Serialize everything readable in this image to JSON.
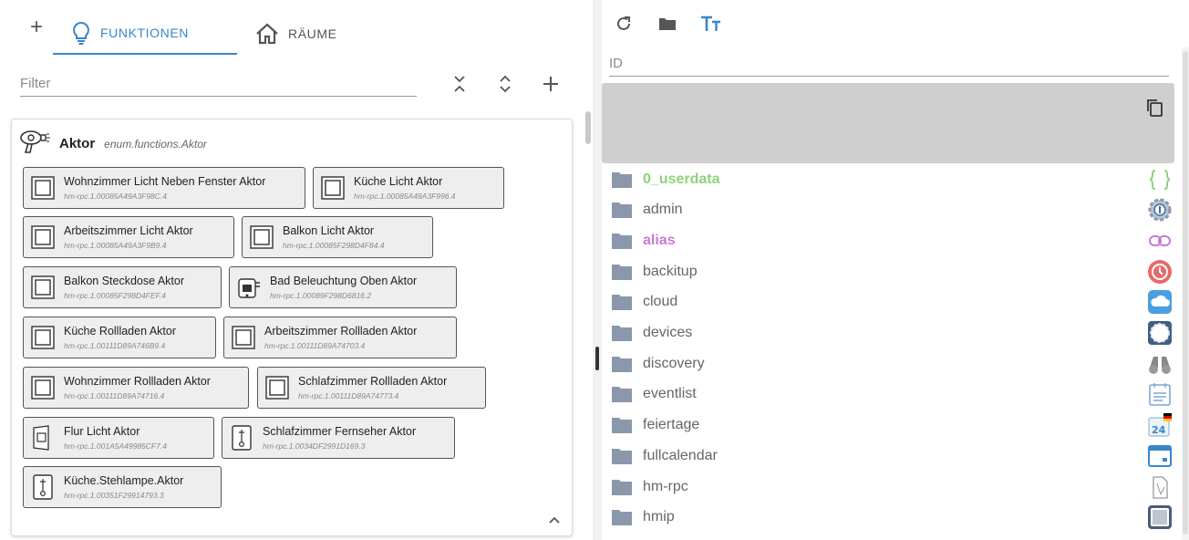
{
  "tabs": {
    "functions_label": "FUNKTIONEN",
    "rooms_label": "RÄUME"
  },
  "filter": {
    "placeholder": "Filter"
  },
  "enum": {
    "title": "Aktor",
    "id": "enum.functions.Aktor",
    "icon": "hair-dryer-icon",
    "members": [
      {
        "name": "Wohnzimmer Licht Neben Fenster Aktor",
        "id": "hm-rpc.1.00085A49A3F98C.4",
        "icon": "switch-icon"
      },
      {
        "name": "Küche Licht Aktor",
        "id": "hm-rpc.1.00085A49A3F996.4",
        "icon": "switch-icon"
      },
      {
        "name": "Arbeitszimmer Licht Aktor",
        "id": "hm-rpc.1.00085A49A3F9B9.4",
        "icon": "switch-icon"
      },
      {
        "name": "Balkon Licht Aktor",
        "id": "hm-rpc.1.00085F298D4F84.4",
        "icon": "switch-icon"
      },
      {
        "name": "Balkon Steckdose Aktor",
        "id": "hm-rpc.1.00085F298D4FEF.4",
        "icon": "switch-icon"
      },
      {
        "name": "Bad Beleuchtung Oben Aktor",
        "id": "hm-rpc.1.00089F298D6816.2",
        "icon": "flush-actuator-icon"
      },
      {
        "name": "Küche Rollladen Aktor",
        "id": "hm-rpc.1.00111D89A746B9.4",
        "icon": "switch-icon"
      },
      {
        "name": "Arbeitszimmer Rollladen Aktor",
        "id": "hm-rpc.1.00111D89A74703.4",
        "icon": "switch-icon"
      },
      {
        "name": "Wohnzimmer Rollladen Aktor",
        "id": "hm-rpc.1.00111D89A74716.4",
        "icon": "switch-icon"
      },
      {
        "name": "Schlafzimmer Rollladen Aktor",
        "id": "hm-rpc.1.00111D89A74773.4",
        "icon": "switch-icon"
      },
      {
        "name": "Flur Licht Aktor",
        "id": "hm-rpc.1.001A5A49985CF7.4",
        "icon": "door-switch-icon"
      },
      {
        "name": "Schlafzimmer Fernseher Aktor",
        "id": "hm-rpc.1.0034DF2991D169.3",
        "icon": "plug-switch-icon"
      },
      {
        "name": "Küche.Stehlampe.Aktor",
        "id": "hm-rpc.1.00351F29914793.3",
        "icon": "plug-switch-icon"
      }
    ]
  },
  "object_browser": {
    "id_placeholder": "ID",
    "items": [
      {
        "label": "0_userdata",
        "color": "#8fd27e",
        "bold": true,
        "icon": "braces-icon"
      },
      {
        "label": "admin",
        "color": "#666666",
        "bold": false,
        "icon": "admin-gear-icon"
      },
      {
        "label": "alias",
        "color": "#c77ad6",
        "bold": true,
        "icon": "link-icon"
      },
      {
        "label": "backitup",
        "color": "#666666",
        "bold": false,
        "icon": "backup-clock-icon"
      },
      {
        "label": "cloud",
        "color": "#666666",
        "bold": false,
        "icon": "cloud-icon"
      },
      {
        "label": "devices",
        "color": "#666666",
        "bold": false,
        "icon": "devices-icon"
      },
      {
        "label": "discovery",
        "color": "#666666",
        "bold": false,
        "icon": "binoculars-icon"
      },
      {
        "label": "eventlist",
        "color": "#666666",
        "bold": false,
        "icon": "eventlist-icon"
      },
      {
        "label": "feiertage",
        "color": "#666666",
        "bold": false,
        "icon": "calendar-24-icon"
      },
      {
        "label": "fullcalendar",
        "color": "#666666",
        "bold": false,
        "icon": "fullcalendar-icon"
      },
      {
        "label": "hm-rpc",
        "color": "#666666",
        "bold": false,
        "icon": "hm-rpc-icon"
      },
      {
        "label": "hmip",
        "color": "#666666",
        "bold": false,
        "icon": "hmip-icon"
      }
    ]
  }
}
